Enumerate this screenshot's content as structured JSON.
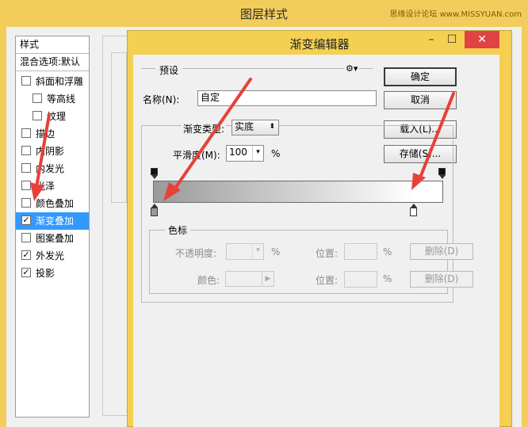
{
  "outer_window": {
    "title": "图层样式",
    "watermark": "思缘设计论坛 www.MISSYUAN.com"
  },
  "style_list": {
    "header": "样式",
    "blend_options": "混合选项:默认",
    "items": [
      {
        "label": "斜面和浮雕",
        "checked": false
      },
      {
        "label": "等高线",
        "checked": false
      },
      {
        "label": "纹理",
        "checked": false
      },
      {
        "label": "描边",
        "checked": false
      },
      {
        "label": "内阴影",
        "checked": false
      },
      {
        "label": "内发光",
        "checked": false
      },
      {
        "label": "光泽",
        "checked": false
      },
      {
        "label": "颜色叠加",
        "checked": false
      },
      {
        "label": "渐变叠加",
        "checked": true,
        "selected": true
      },
      {
        "label": "图案叠加",
        "checked": false
      },
      {
        "label": "外发光",
        "checked": true
      },
      {
        "label": "投影",
        "checked": true
      }
    ]
  },
  "gradient_editor": {
    "title": "渐变编辑器",
    "presets_label": "预设",
    "ok_button": "确定",
    "cancel_button": "取消",
    "load_button": "载入(L)...",
    "save_button": "存储(S)...",
    "name_label": "名称(N):",
    "name_value": "自定",
    "gradient_type_label": "渐变类型:",
    "gradient_type_value": "实底",
    "smoothness_label": "平滑度(M):",
    "smoothness_value": "100",
    "percent": "%",
    "gradient_start_color": "#9a9a9a",
    "gradient_end_color": "#ffffff",
    "stops_group_label": "色标",
    "opacity_label": "不透明度:",
    "opacity_unit": "%",
    "location_label": "位置:",
    "location_unit": "%",
    "delete_button": "删除(D)",
    "color_label": "颜色:"
  },
  "annotation_color": "#e8403a"
}
